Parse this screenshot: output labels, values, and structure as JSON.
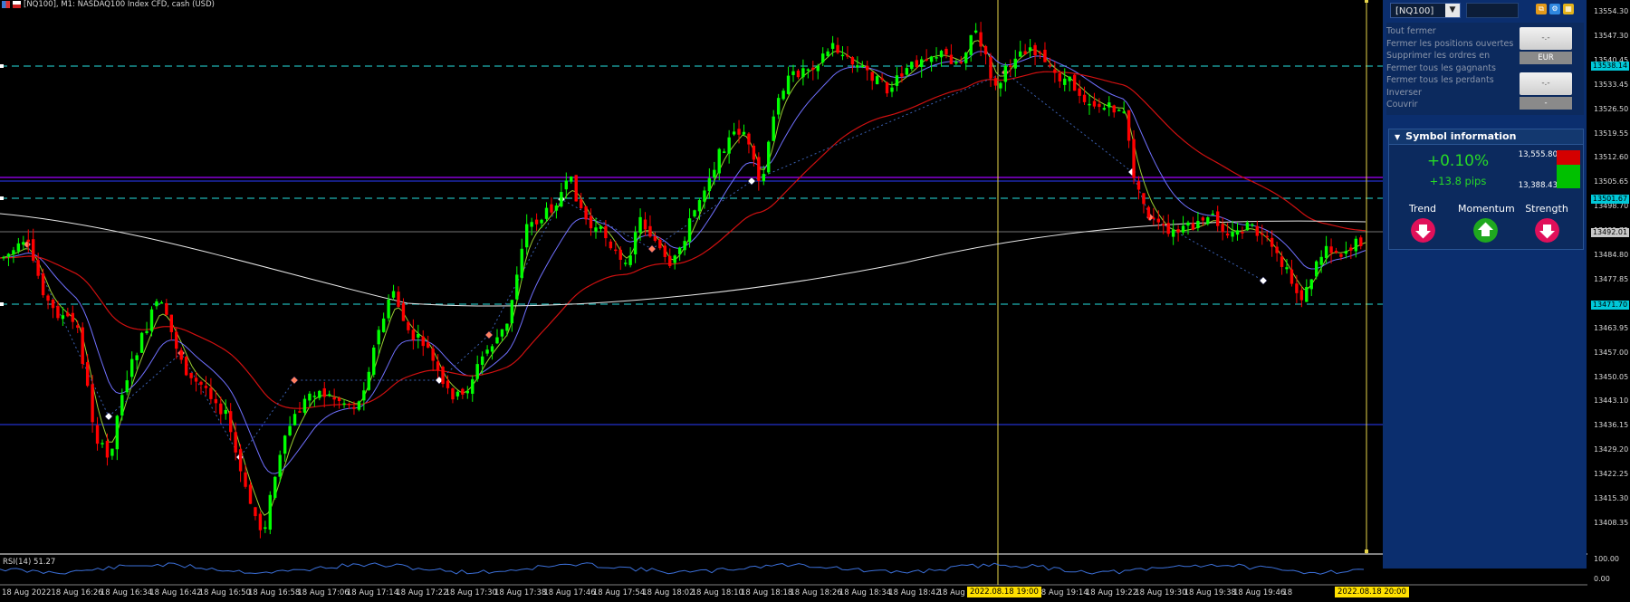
{
  "window": {
    "title": "[NQ100], M1:  NASDAQ100 Index CFD, cash (USD)"
  },
  "panel": {
    "symbol": "[NQ100]",
    "commands": [
      "Tout fermer",
      "Fermer les positions ouvertes",
      "Supprimer les ordres en",
      "Fermer tous les gagnants",
      "Fermer tous les perdants",
      "Inverser",
      "Couvrir"
    ],
    "button1_label": "-.-",
    "currency": "EUR",
    "button2_label": "-.-",
    "button2_sub": "-"
  },
  "symbol_info": {
    "header": "Symbol information",
    "change_pct": "+0.10%",
    "change_pips": "+13.8 pips",
    "high": "13,555.80",
    "low": "13,388.43",
    "indicators": [
      {
        "label": "Trend",
        "direction": "down",
        "icon": "arrow-down-icon",
        "color": "#e0105a"
      },
      {
        "label": "Momentum",
        "direction": "up",
        "icon": "arrow-up-icon",
        "color": "#1fa81f"
      },
      {
        "label": "Strength",
        "direction": "down",
        "icon": "arrow-down-icon",
        "color": "#e0105a"
      }
    ]
  },
  "price_axis": {
    "ticks": [
      "13554.30",
      "13547.30",
      "13540.45",
      "13533.45",
      "13526.50",
      "13519.55",
      "13512.60",
      "13505.65",
      "13498.70",
      "13491.75",
      "13484.80",
      "13477.85",
      "13470.90",
      "13463.95",
      "13457.00",
      "13450.05",
      "13443.10",
      "13436.15",
      "13429.20",
      "13422.25",
      "13415.30",
      "13408.35"
    ],
    "tags": [
      {
        "text": "13538.14",
        "color": "#00c8d8"
      },
      {
        "text": "13501.67",
        "color": "#00c8d8"
      },
      {
        "text": "13492.01",
        "color": "#c8c8c8"
      },
      {
        "text": "13471.70",
        "color": "#00c8d8"
      }
    ]
  },
  "rsi": {
    "label": "RSI(14) 51.27",
    "max": "100.00",
    "min": "0.00"
  },
  "time_axis": {
    "labels": [
      "18 Aug 2022",
      "18 Aug 16:26",
      "18 Aug 16:34",
      "18 Aug 16:42",
      "18 Aug 16:50",
      "18 Aug 16:58",
      "18 Aug 17:06",
      "18 Aug 17:14",
      "18 Aug 17:22",
      "18 Aug 17:30",
      "18 Aug 17:38",
      "18 Aug 17:46",
      "18 Aug 17:54",
      "18 Aug 18:02",
      "18 Aug 18:10",
      "18 Aug 18:18",
      "18 Aug 18:26",
      "18 Aug 18:34",
      "18 Aug 18:42",
      "18 Aug 18:5",
      "18 Aug 19:06",
      "18 Aug 19:14",
      "18 Aug 19:22",
      "18 Aug 19:30",
      "18 Aug 19:38",
      "18 Aug 19:46",
      "18"
    ],
    "tags": [
      "2022.08.18 19:00",
      "2022.08.18 20:00"
    ]
  },
  "colors": {
    "bull": "#00ff00",
    "bear": "#ff0000",
    "panel": "#0b2e6e",
    "accent": "#ffe000"
  }
}
